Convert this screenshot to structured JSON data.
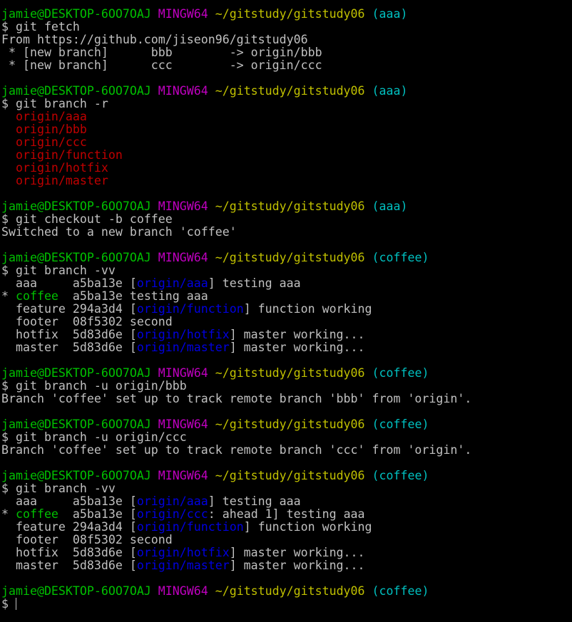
{
  "window": {
    "title": ""
  },
  "prompt": {
    "user_host": "jamie@DESKTOP-6OO7OAJ",
    "env": "MINGW64",
    "path": "~/gitstudy/gitstudy06",
    "symbol": "$"
  },
  "colors": {
    "green": "#00c000",
    "magenta": "#c000c0",
    "yellow": "#c0c000",
    "cyan": "#00c0c0",
    "red": "#c00000",
    "blue": "#0000e0",
    "default": "#c0c0c0",
    "background": "#000000"
  },
  "lines": [
    {
      "type": "prompt",
      "branch": "(aaa)"
    },
    {
      "type": "segments",
      "segments": [
        {
          "text": "$ git fetch",
          "color": "default"
        }
      ]
    },
    {
      "type": "segments",
      "segments": [
        {
          "text": "From https://github.com/jiseon96/gitstudy06",
          "color": "default"
        }
      ]
    },
    {
      "type": "segments",
      "segments": [
        {
          "text": " * [new branch]      bbb        -> origin/bbb",
          "color": "default"
        }
      ]
    },
    {
      "type": "segments",
      "segments": [
        {
          "text": " * [new branch]      ccc        -> origin/ccc",
          "color": "default"
        }
      ]
    },
    {
      "type": "blank"
    },
    {
      "type": "prompt",
      "branch": "(aaa)"
    },
    {
      "type": "segments",
      "segments": [
        {
          "text": "$ git branch -r",
          "color": "default"
        }
      ]
    },
    {
      "type": "segments",
      "segments": [
        {
          "text": "  ",
          "color": "default"
        },
        {
          "text": "origin/aaa",
          "color": "red"
        }
      ]
    },
    {
      "type": "segments",
      "segments": [
        {
          "text": "  ",
          "color": "default"
        },
        {
          "text": "origin/bbb",
          "color": "red"
        }
      ]
    },
    {
      "type": "segments",
      "segments": [
        {
          "text": "  ",
          "color": "default"
        },
        {
          "text": "origin/ccc",
          "color": "red"
        }
      ]
    },
    {
      "type": "segments",
      "segments": [
        {
          "text": "  ",
          "color": "default"
        },
        {
          "text": "origin/function",
          "color": "red"
        }
      ]
    },
    {
      "type": "segments",
      "segments": [
        {
          "text": "  ",
          "color": "default"
        },
        {
          "text": "origin/hotfix",
          "color": "red"
        }
      ]
    },
    {
      "type": "segments",
      "segments": [
        {
          "text": "  ",
          "color": "default"
        },
        {
          "text": "origin/master",
          "color": "red"
        }
      ]
    },
    {
      "type": "blank"
    },
    {
      "type": "prompt",
      "branch": "(aaa)"
    },
    {
      "type": "segments",
      "segments": [
        {
          "text": "$ git checkout -b coffee",
          "color": "default"
        }
      ]
    },
    {
      "type": "segments",
      "segments": [
        {
          "text": "Switched to a new branch 'coffee'",
          "color": "default"
        }
      ]
    },
    {
      "type": "blank"
    },
    {
      "type": "prompt",
      "branch": "(coffee)"
    },
    {
      "type": "segments",
      "segments": [
        {
          "text": "$ git branch -vv",
          "color": "default"
        }
      ]
    },
    {
      "type": "segments",
      "segments": [
        {
          "text": "  aaa     a5ba13e [",
          "color": "default"
        },
        {
          "text": "origin/aaa",
          "color": "blue"
        },
        {
          "text": "] testing aaa",
          "color": "default"
        }
      ]
    },
    {
      "type": "segments",
      "segments": [
        {
          "text": "* ",
          "color": "default"
        },
        {
          "text": "coffee",
          "color": "green"
        },
        {
          "text": "  a5ba13e testing aaa",
          "color": "default"
        }
      ]
    },
    {
      "type": "segments",
      "segments": [
        {
          "text": "  feature 294a3d4 [",
          "color": "default"
        },
        {
          "text": "origin/function",
          "color": "blue"
        },
        {
          "text": "] function working",
          "color": "default"
        }
      ]
    },
    {
      "type": "segments",
      "segments": [
        {
          "text": "  footer  08f5302 second",
          "color": "default"
        }
      ]
    },
    {
      "type": "segments",
      "segments": [
        {
          "text": "  hotfix  5d83d6e [",
          "color": "default"
        },
        {
          "text": "origin/hotfix",
          "color": "blue"
        },
        {
          "text": "] master working...",
          "color": "default"
        }
      ]
    },
    {
      "type": "segments",
      "segments": [
        {
          "text": "  master  5d83d6e [",
          "color": "default"
        },
        {
          "text": "origin/master",
          "color": "blue"
        },
        {
          "text": "] master working...",
          "color": "default"
        }
      ]
    },
    {
      "type": "blank"
    },
    {
      "type": "prompt",
      "branch": "(coffee)"
    },
    {
      "type": "segments",
      "segments": [
        {
          "text": "$ git branch -u origin/bbb",
          "color": "default"
        }
      ]
    },
    {
      "type": "segments",
      "segments": [
        {
          "text": "Branch 'coffee' set up to track remote branch 'bbb' from 'origin'.",
          "color": "default"
        }
      ]
    },
    {
      "type": "blank"
    },
    {
      "type": "prompt",
      "branch": "(coffee)"
    },
    {
      "type": "segments",
      "segments": [
        {
          "text": "$ git branch -u origin/ccc",
          "color": "default"
        }
      ]
    },
    {
      "type": "segments",
      "segments": [
        {
          "text": "Branch 'coffee' set up to track remote branch 'ccc' from 'origin'.",
          "color": "default"
        }
      ]
    },
    {
      "type": "blank"
    },
    {
      "type": "prompt",
      "branch": "(coffee)"
    },
    {
      "type": "segments",
      "segments": [
        {
          "text": "$ git branch -vv",
          "color": "default"
        }
      ]
    },
    {
      "type": "segments",
      "segments": [
        {
          "text": "  aaa     a5ba13e [",
          "color": "default"
        },
        {
          "text": "origin/aaa",
          "color": "blue"
        },
        {
          "text": "] testing aaa",
          "color": "default"
        }
      ]
    },
    {
      "type": "segments",
      "segments": [
        {
          "text": "* ",
          "color": "default"
        },
        {
          "text": "coffee",
          "color": "green"
        },
        {
          "text": "  a5ba13e [",
          "color": "default"
        },
        {
          "text": "origin/ccc",
          "color": "blue"
        },
        {
          "text": ": ahead 1] testing aaa",
          "color": "default"
        }
      ]
    },
    {
      "type": "segments",
      "segments": [
        {
          "text": "  feature 294a3d4 [",
          "color": "default"
        },
        {
          "text": "origin/function",
          "color": "blue"
        },
        {
          "text": "] function working",
          "color": "default"
        }
      ]
    },
    {
      "type": "segments",
      "segments": [
        {
          "text": "  footer  08f5302 second",
          "color": "default"
        }
      ]
    },
    {
      "type": "segments",
      "segments": [
        {
          "text": "  hotfix  5d83d6e [",
          "color": "default"
        },
        {
          "text": "origin/hotfix",
          "color": "blue"
        },
        {
          "text": "] master working...",
          "color": "default"
        }
      ]
    },
    {
      "type": "segments",
      "segments": [
        {
          "text": "  master  5d83d6e [",
          "color": "default"
        },
        {
          "text": "origin/master",
          "color": "blue"
        },
        {
          "text": "] master working...",
          "color": "default"
        }
      ]
    },
    {
      "type": "blank"
    },
    {
      "type": "prompt",
      "branch": "(coffee)"
    },
    {
      "type": "input",
      "text": "$ "
    }
  ]
}
